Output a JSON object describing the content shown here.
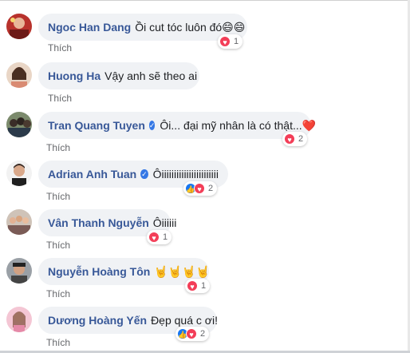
{
  "comments": [
    {
      "author": "Ngoc Han Dang",
      "verified": false,
      "text": "Ồi cut tóc luôn đó😄😄",
      "reaction_count": "1",
      "reactions": [
        "love"
      ],
      "action": ""
    },
    {
      "author": "Huong Ha",
      "verified": false,
      "text": "Vậy anh sẽ theo ai",
      "reaction_count": "",
      "reactions": [],
      "action": "Thích"
    },
    {
      "author": "Tran Quang Tuyen",
      "verified": true,
      "text": "Ôi... đại mỹ nhân là có thật...❤️",
      "reaction_count": "2",
      "reactions": [
        "love"
      ],
      "action": "Thích"
    },
    {
      "author": "Adrian Anh Tuan",
      "verified": true,
      "text": "Ôiiiiiiiiiiiiiiiiiiiiiii",
      "reaction_count": "2",
      "reactions": [
        "like",
        "love"
      ],
      "action": "Thích"
    },
    {
      "author": "Vân Thanh Nguyễn",
      "verified": false,
      "text": "Ôiiiiii",
      "reaction_count": "1",
      "reactions": [
        "love"
      ],
      "action": "Thích"
    },
    {
      "author": "Nguyễn Hoàng Tôn",
      "verified": false,
      "text": "🤘🤘🤘🤘",
      "reaction_count": "1",
      "reactions": [
        "love"
      ],
      "action": "Thích"
    },
    {
      "author": "Dương Hoàng Yến",
      "verified": false,
      "text": "Đẹp quá c ơi!",
      "reaction_count": "2",
      "reactions": [
        "like",
        "love"
      ],
      "action": "Thích"
    }
  ],
  "colors": {
    "author": "#385898",
    "bubble": "#f0f2f5",
    "love": "#f33e58",
    "like": "#1877f2",
    "muted": "#65676b"
  }
}
